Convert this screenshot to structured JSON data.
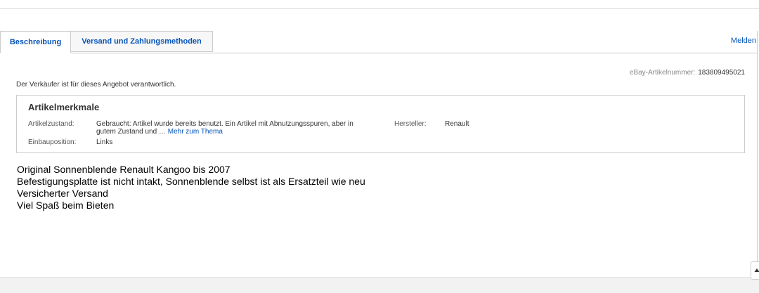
{
  "tabs": [
    {
      "label": "Beschreibung",
      "active": true
    },
    {
      "label": "Versand und Zahlungsmethoden",
      "active": false
    }
  ],
  "report_link": "Melden",
  "item_number": {
    "label": "eBay-Artikelnummer:",
    "value": "183809495021"
  },
  "seller_note": "Der Verkäufer ist für dieses Angebot verantwortlich.",
  "specs": {
    "title": "Artikelmerkmale",
    "condition_label": "Artikelzustand:",
    "condition_value_line1": "Gebraucht: Artikel wurde bereits benutzt. Ein Artikel mit Abnutzungsspuren, aber in",
    "condition_value_line2": "gutem Zustand und …",
    "more_link": "Mehr zum Thema",
    "manufacturer_label": "Hersteller:",
    "manufacturer_value": "Renault",
    "position_label": "Einbauposition:",
    "position_value": "Links"
  },
  "description": [
    "Original Sonnenblende Renault Kangoo bis 2007",
    "Befestigungsplatte ist nicht intakt, Sonnenblende selbst ist als Ersatzteil wie neu",
    "Versicherter Versand",
    "Viel Spaß beim Bieten"
  ],
  "colors": {
    "link": "#0654ba",
    "border": "#cccccc"
  },
  "icons": {
    "scroll_top": "arrow-up-icon"
  }
}
